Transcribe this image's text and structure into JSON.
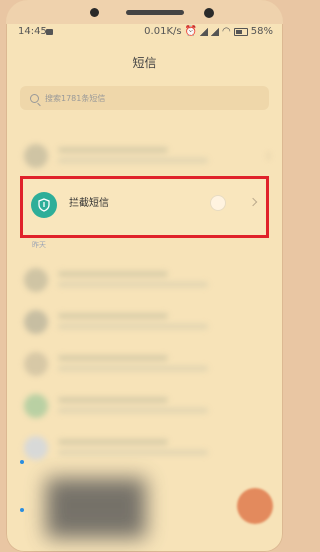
{
  "status_bar": {
    "time": "14:45",
    "speed": "0.01K/s",
    "battery": "58%"
  },
  "header": {
    "title": "短信"
  },
  "search": {
    "placeholder": "搜索1781条短信"
  },
  "blocked_item": {
    "label": "拦截短信"
  },
  "section": {
    "yesterday": "昨天"
  },
  "colors": {
    "highlight_border": "#e0222a",
    "shield_bg": "#2eae99",
    "background": "#f7e3b8"
  }
}
